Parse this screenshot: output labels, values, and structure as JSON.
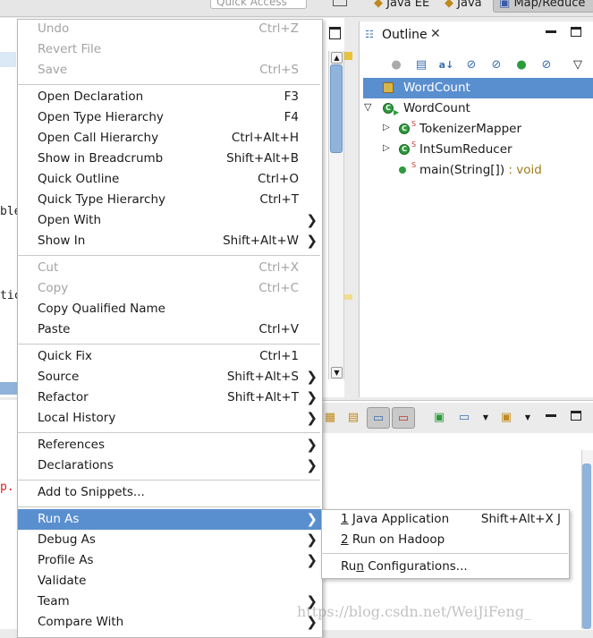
{
  "topbar": {
    "quick_access_placeholder": "Quick Access",
    "perspectives": [
      "Java EE",
      "Java",
      "Map/Reduce"
    ]
  },
  "editor": {
    "code_fragments": [
      "ble",
      "tic"
    ],
    "error_fragment": "p."
  },
  "outline": {
    "title": "Outline",
    "tree": {
      "root_selected": "WordCount",
      "class": "WordCount",
      "children": [
        {
          "name": "TokenizerMapper",
          "modifier": "S"
        },
        {
          "name": "IntSumReducer",
          "modifier": "S"
        },
        {
          "name": "main(String[])",
          "modifier": "S",
          "type": " : void"
        }
      ]
    }
  },
  "context_menu": {
    "items": [
      {
        "label": "Undo",
        "accel": "Ctrl+Z",
        "disabled": true
      },
      {
        "label": "Revert File",
        "accel": "",
        "disabled": true
      },
      {
        "label": "Save",
        "accel": "Ctrl+S",
        "disabled": true
      },
      {
        "label": "Open Declaration",
        "accel": "F3"
      },
      {
        "label": "Open Type Hierarchy",
        "accel": "F4"
      },
      {
        "label": "Open Call Hierarchy",
        "accel": "Ctrl+Alt+H"
      },
      {
        "label": "Show in Breadcrumb",
        "accel": "Shift+Alt+B"
      },
      {
        "label": "Quick Outline",
        "accel": "Ctrl+O"
      },
      {
        "label": "Quick Type Hierarchy",
        "accel": "Ctrl+T"
      },
      {
        "label": "Open With",
        "accel": ""
      },
      {
        "label": "Show In",
        "accel": "Shift+Alt+W"
      },
      {
        "label": "Cut",
        "accel": "Ctrl+X",
        "disabled": true
      },
      {
        "label": "Copy",
        "accel": "Ctrl+C",
        "disabled": true
      },
      {
        "label": "Copy Qualified Name",
        "accel": ""
      },
      {
        "label": "Paste",
        "accel": "Ctrl+V"
      },
      {
        "label": "Quick Fix",
        "accel": "Ctrl+1"
      },
      {
        "label": "Source",
        "accel": "Shift+Alt+S"
      },
      {
        "label": "Refactor",
        "accel": "Shift+Alt+T"
      },
      {
        "label": "Local History",
        "accel": ""
      },
      {
        "label": "References",
        "accel": ""
      },
      {
        "label": "Declarations",
        "accel": ""
      },
      {
        "label": "Add to Snippets...",
        "accel": ""
      },
      {
        "label": "Run As",
        "accel": "",
        "active": true
      },
      {
        "label": "Debug As",
        "accel": ""
      },
      {
        "label": "Profile As",
        "accel": ""
      },
      {
        "label": "Validate",
        "accel": ""
      },
      {
        "label": "Team",
        "accel": ""
      },
      {
        "label": "Compare With",
        "accel": ""
      }
    ]
  },
  "run_as_submenu": {
    "items": [
      {
        "num": "1",
        "label": " Java Application",
        "accel": "Shift+Alt+X J"
      },
      {
        "num": "2",
        "label": " Run on Hadoop",
        "accel": ""
      },
      {
        "pre": "Ru",
        "ul": "n",
        "post": " Configurations...",
        "accel": ""
      }
    ]
  },
  "watermark": "https://blog.csdn.net/WeiJiFeng_"
}
